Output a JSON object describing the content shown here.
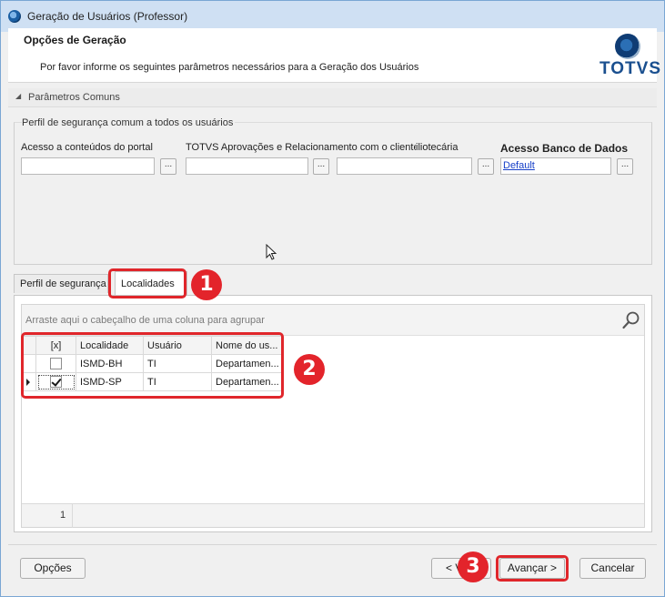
{
  "window": {
    "title": "Geração de Usuários (Professor)"
  },
  "header": {
    "title": "Opções de Geração",
    "subtitle": "Por favor informe os seguintes parâmetros necessários para a Geração dos Usuários",
    "logo_text": "TOTVS"
  },
  "section": {
    "label": "Parâmetros Comuns",
    "collapse_icon": "triangle-collapse-icon"
  },
  "params": {
    "group_label": "Perfil de segurança comum a todos os usuários",
    "fields": [
      {
        "label": "Acesso a conteúdos do portal",
        "value": ""
      },
      {
        "label": "TOTVS Aprovações e Relacionamento com o cliente",
        "value": ""
      },
      {
        "label": "iliotecária",
        "value": ""
      },
      {
        "label": "Acesso Banco de Dados",
        "value": "Default"
      }
    ],
    "browse_label": "..."
  },
  "tabs": [
    {
      "label": "Perfil de segurança",
      "active": false
    },
    {
      "label": "Localidades",
      "active": true
    }
  ],
  "grid": {
    "group_hint": "Arraste aqui o cabeçalho de uma coluna para agrupar",
    "search_icon": "search-icon",
    "columns": [
      "[x]",
      "Localidade",
      "Usuário",
      "Nome do us..."
    ],
    "rows": [
      {
        "checked": false,
        "localidade": "ISMD-BH",
        "usuario": "TI",
        "nome": "Departamen..."
      },
      {
        "checked": true,
        "localidade": "ISMD-SP",
        "usuario": "TI",
        "nome": "Departamen..."
      }
    ],
    "footer_count": "1"
  },
  "buttons": {
    "options": "Opções",
    "back": "< V",
    "next": "Avançar >",
    "cancel": "Cancelar"
  },
  "annotations": {
    "badge1": "1",
    "badge2": "2",
    "badge3": "3",
    "color": "#e3242b"
  }
}
